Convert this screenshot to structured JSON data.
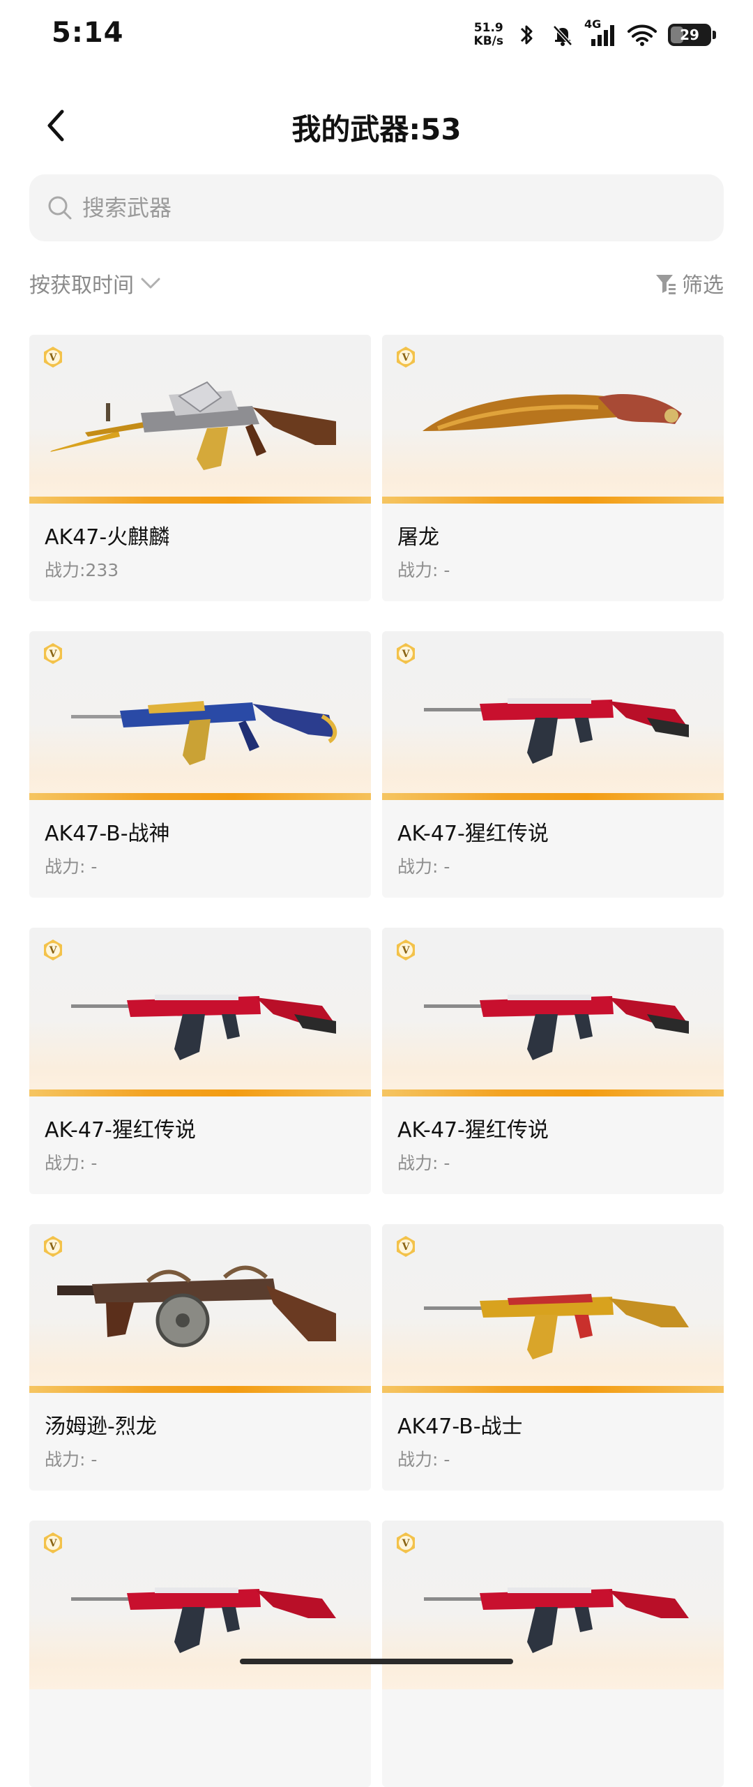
{
  "status": {
    "time": "5:14",
    "net_speed_value": "51.9",
    "net_speed_unit": "KB/s",
    "signal_type": "4G",
    "battery": "29"
  },
  "header": {
    "title": "我的武器:53"
  },
  "search": {
    "placeholder": "搜索武器"
  },
  "sort": {
    "label": "按获取时间"
  },
  "filter": {
    "label": "筛选"
  },
  "accent": {
    "bar": "#f39c12",
    "badge": "#f0b33a"
  },
  "weapons": [
    {
      "name": "AK47-火麒麟",
      "power": "战力:233",
      "art": "ak-gold"
    },
    {
      "name": "屠龙",
      "power": "战力: -",
      "art": "knife"
    },
    {
      "name": "AK47-B-战神",
      "power": "战力: -",
      "art": "ak-blue"
    },
    {
      "name": "AK-47-猩红传说",
      "power": "战力: -",
      "art": "ak-red"
    },
    {
      "name": "AK-47-猩红传说",
      "power": "战力: -",
      "art": "ak-red"
    },
    {
      "name": "AK-47-猩红传说",
      "power": "战力: -",
      "art": "ak-red"
    },
    {
      "name": "汤姆逊-烈龙",
      "power": "战力: -",
      "art": "tommy"
    },
    {
      "name": "AK47-B-战士",
      "power": "战力: -",
      "art": "ak-goldred"
    },
    {
      "name": "",
      "power": "",
      "art": "ak-red"
    },
    {
      "name": "",
      "power": "",
      "art": "ak-red"
    }
  ]
}
